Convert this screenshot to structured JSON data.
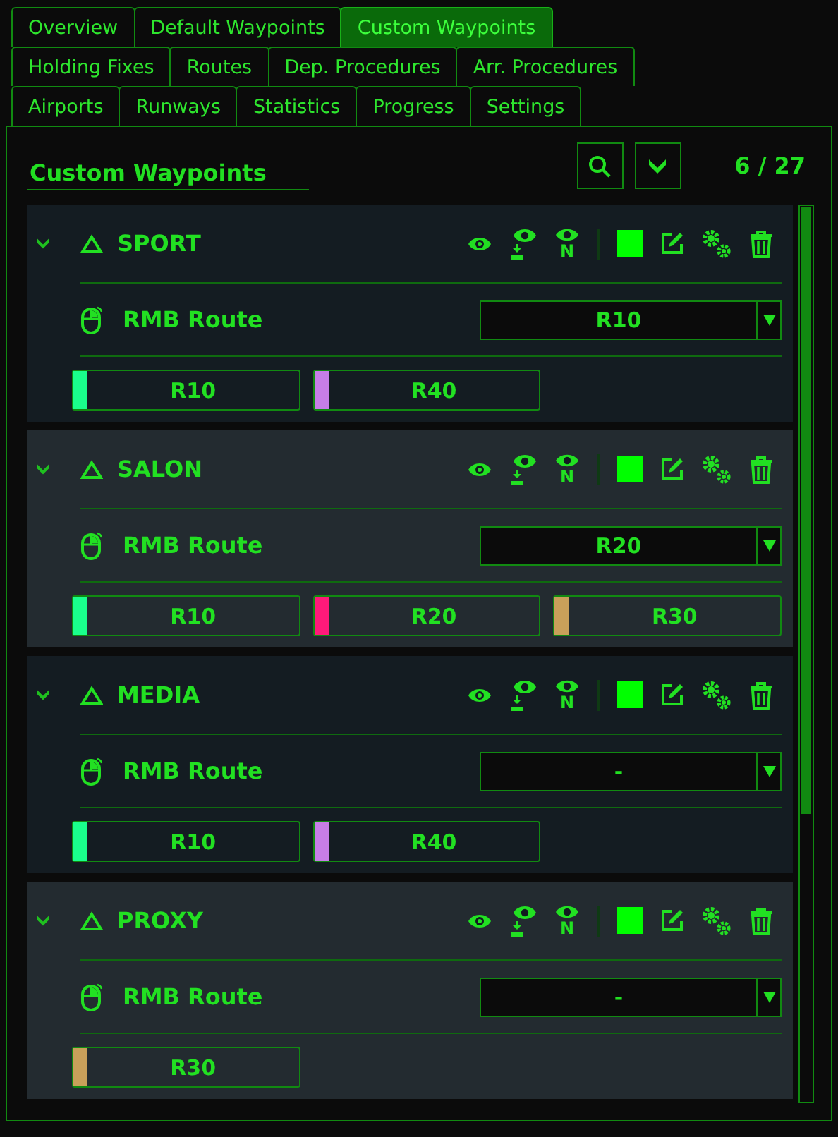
{
  "tab_rows": [
    [
      {
        "label": "Overview",
        "selected": false
      },
      {
        "label": "Default Waypoints",
        "selected": false
      },
      {
        "label": "Custom Waypoints",
        "selected": true
      }
    ],
    [
      {
        "label": "Holding Fixes",
        "selected": false
      },
      {
        "label": "Routes",
        "selected": false
      },
      {
        "label": "Dep. Procedures",
        "selected": false
      },
      {
        "label": "Arr. Procedures",
        "selected": false
      }
    ],
    [
      {
        "label": "Airports",
        "selected": false
      },
      {
        "label": "Runways",
        "selected": false
      },
      {
        "label": "Statistics",
        "selected": false
      },
      {
        "label": "Progress",
        "selected": false
      },
      {
        "label": "Settings",
        "selected": false
      }
    ]
  ],
  "panel": {
    "title": "Custom Waypoints",
    "count": "6 / 27"
  },
  "waypoints": [
    {
      "name": "SPORT",
      "color": "#00ff00",
      "name_eye_label": "N",
      "route_label": "RMB Route",
      "route_value": "R10",
      "routes": [
        {
          "label": "R10",
          "color": "#1aff8c"
        },
        {
          "label": "R40",
          "color": "#c77ee6"
        }
      ]
    },
    {
      "name": "SALON",
      "color": "#00ff00",
      "name_eye_label": "N",
      "route_label": "RMB Route",
      "route_value": "R20",
      "routes": [
        {
          "label": "R10",
          "color": "#1aff8c"
        },
        {
          "label": "R20",
          "color": "#ff1a7a"
        },
        {
          "label": "R30",
          "color": "#c9a05a"
        }
      ]
    },
    {
      "name": "MEDIA",
      "color": "#00ff00",
      "name_eye_label": "N",
      "route_label": "RMB Route",
      "route_value": "-",
      "routes": [
        {
          "label": "R10",
          "color": "#1aff8c"
        },
        {
          "label": "R40",
          "color": "#c77ee6"
        }
      ]
    },
    {
      "name": "PROXY",
      "color": "#00ff00",
      "name_eye_label": "N",
      "route_label": "RMB Route",
      "route_value": "-",
      "routes": [
        {
          "label": "R30",
          "color": "#c9a05a"
        }
      ]
    }
  ]
}
